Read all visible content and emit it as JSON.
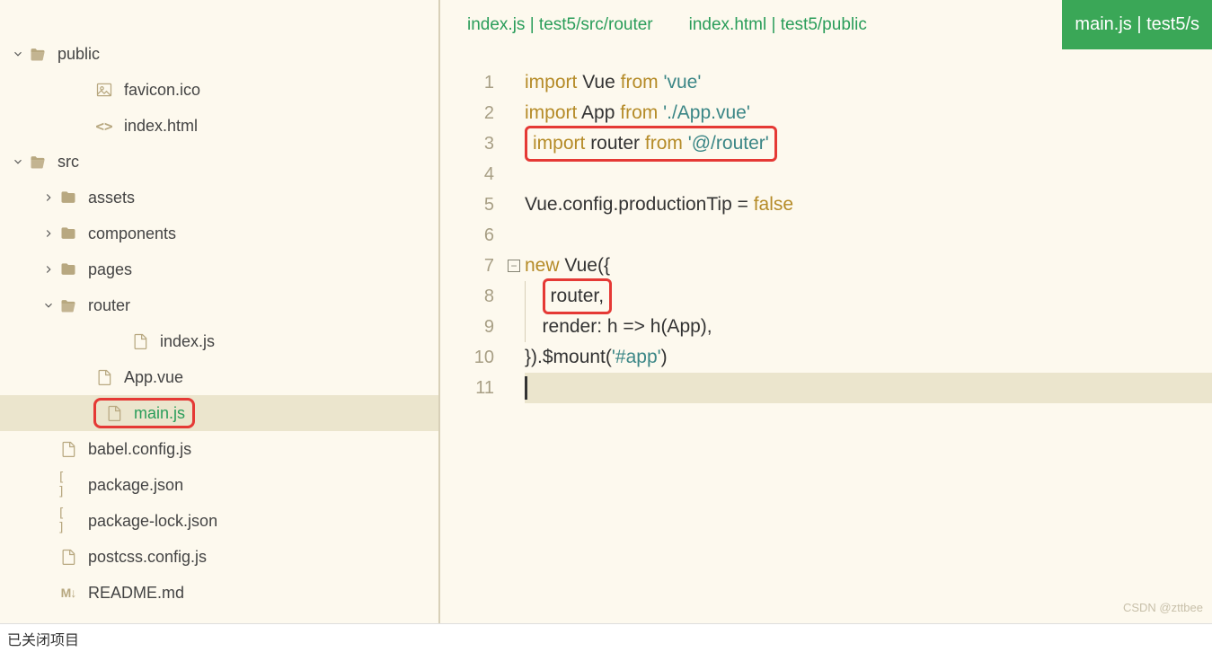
{
  "sidebar": {
    "items": [
      {
        "label": "public",
        "type": "folder-open",
        "depth": 0,
        "chevron": "down"
      },
      {
        "label": "favicon.ico",
        "type": "image",
        "depth": 2
      },
      {
        "label": "index.html",
        "type": "code",
        "depth": 2
      },
      {
        "label": "src",
        "type": "folder-open",
        "depth": 0,
        "chevron": "down"
      },
      {
        "label": "assets",
        "type": "folder",
        "depth": 1,
        "chevron": "right"
      },
      {
        "label": "components",
        "type": "folder",
        "depth": 1,
        "chevron": "right"
      },
      {
        "label": "pages",
        "type": "folder",
        "depth": 1,
        "chevron": "right"
      },
      {
        "label": "router",
        "type": "folder-open",
        "depth": 1,
        "chevron": "down"
      },
      {
        "label": "index.js",
        "type": "js",
        "depth": 3
      },
      {
        "label": "App.vue",
        "type": "vue",
        "depth": 2
      },
      {
        "label": "main.js",
        "type": "js",
        "depth": 2,
        "selected": true,
        "redbox": true,
        "green": true
      },
      {
        "label": "babel.config.js",
        "type": "js",
        "depth": 1
      },
      {
        "label": "package.json",
        "type": "json",
        "depth": 1
      },
      {
        "label": "package-lock.json",
        "type": "json",
        "depth": 1
      },
      {
        "label": "postcss.config.js",
        "type": "js",
        "depth": 1
      },
      {
        "label": "README.md",
        "type": "md",
        "depth": 1
      }
    ]
  },
  "tabs": [
    {
      "label": "index.js | test5/src/router",
      "active": false
    },
    {
      "label": "index.html | test5/public",
      "active": false
    },
    {
      "label": "main.js | test5/s",
      "active": true
    }
  ],
  "code": {
    "lines": [
      {
        "n": 1,
        "tokens": [
          {
            "t": "import",
            "c": "kw"
          },
          {
            "t": " Vue ",
            "c": "var"
          },
          {
            "t": "from",
            "c": "kw"
          },
          {
            "t": " ",
            "c": ""
          },
          {
            "t": "'vue'",
            "c": "id"
          }
        ]
      },
      {
        "n": 2,
        "tokens": [
          {
            "t": "import",
            "c": "kw"
          },
          {
            "t": " App ",
            "c": "var"
          },
          {
            "t": "from",
            "c": "kw"
          },
          {
            "t": " ",
            "c": ""
          },
          {
            "t": "'./App.vue'",
            "c": "id"
          }
        ]
      },
      {
        "n": 3,
        "redbox": true,
        "tokens": [
          {
            "t": "import",
            "c": "kw"
          },
          {
            "t": " router ",
            "c": "var"
          },
          {
            "t": "from",
            "c": "kw"
          },
          {
            "t": " ",
            "c": ""
          },
          {
            "t": "'@/router'",
            "c": "id"
          }
        ]
      },
      {
        "n": 4,
        "tokens": []
      },
      {
        "n": 5,
        "tokens": [
          {
            "t": "Vue.config.productionTip = ",
            "c": "var"
          },
          {
            "t": "false",
            "c": "kw"
          }
        ]
      },
      {
        "n": 6,
        "tokens": []
      },
      {
        "n": 7,
        "fold": true,
        "tokens": [
          {
            "t": "new",
            "c": "kw"
          },
          {
            "t": " Vue({",
            "c": "var"
          }
        ]
      },
      {
        "n": 8,
        "indent": 1,
        "redbox": true,
        "tokens": [
          {
            "t": "router,",
            "c": "var"
          }
        ]
      },
      {
        "n": 9,
        "indent": 1,
        "tokens": [
          {
            "t": "render: h => h(App),",
            "c": "var"
          }
        ]
      },
      {
        "n": 10,
        "tokens": [
          {
            "t": "}).$mount(",
            "c": "var"
          },
          {
            "t": "'#app'",
            "c": "id"
          },
          {
            "t": ")",
            "c": "var"
          }
        ]
      },
      {
        "n": 11,
        "current": true,
        "cursor": true,
        "tokens": []
      }
    ]
  },
  "status": "已关闭项目",
  "watermark": "CSDN @zttbee"
}
